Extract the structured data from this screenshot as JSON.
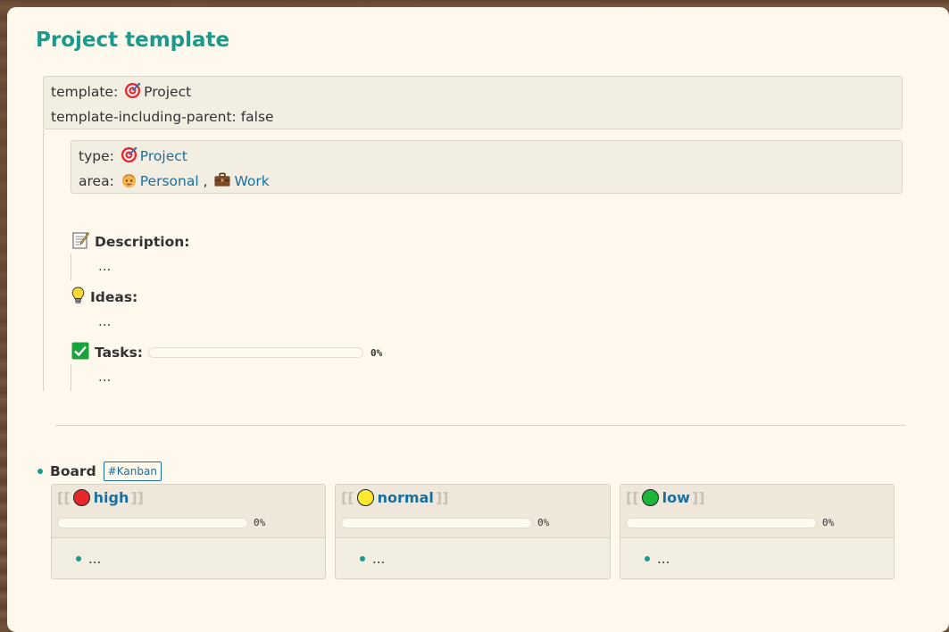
{
  "page": {
    "title": "Project template"
  },
  "template_props": {
    "template_key": "template:",
    "template_value": "Project",
    "including_parent_key": "template-including-parent:",
    "including_parent_value": "false"
  },
  "page_props": {
    "type_key": "type:",
    "type_value": "Project",
    "area_key": "area:",
    "area_personal": "Personal",
    "area_separator": ",",
    "area_work": "Work"
  },
  "sections": {
    "description": {
      "label": "Description:",
      "content": "..."
    },
    "ideas": {
      "label": "Ideas:",
      "content": "..."
    },
    "tasks": {
      "label": "Tasks:",
      "progress_text": "0%",
      "progress": 0,
      "content": "..."
    }
  },
  "board": {
    "label": "Board",
    "tag": "#Kanban",
    "bracket_open": "[[",
    "bracket_close": "]]",
    "columns": [
      {
        "name": "high",
        "color": "#e8262c",
        "progress_text": "0%",
        "progress": 0,
        "item": "..."
      },
      {
        "name": "normal",
        "color": "#ffea2e",
        "progress_text": "0%",
        "progress": 0,
        "item": "..."
      },
      {
        "name": "low",
        "color": "#1db53c",
        "progress_text": "0%",
        "progress": 0,
        "item": "..."
      }
    ]
  },
  "colors": {
    "accent": "#1a9a8c",
    "link": "#1a6fa0",
    "card_background": "#fff8ec"
  },
  "icons": {
    "project": "target-icon",
    "personal": "person-face-icon",
    "work": "briefcase-icon",
    "description": "memo-icon",
    "ideas": "lightbulb-icon",
    "tasks": "check-box-icon"
  }
}
